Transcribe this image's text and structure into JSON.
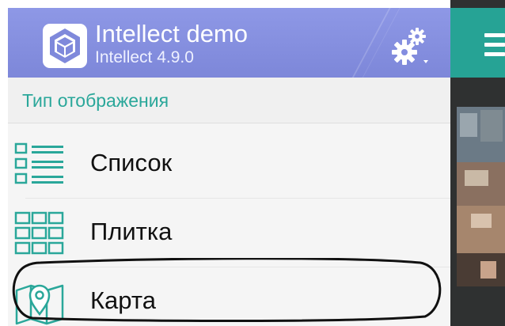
{
  "app": {
    "title": "Intellect demo",
    "version": "Intellect 4.9.0",
    "header_color": "#8792e0",
    "accent_color": "#2aa79a"
  },
  "header": {
    "logo_icon": "intellect-logo-icon",
    "settings_icon": "gears-icon"
  },
  "view_menu": {
    "section_label": "Тип отображения",
    "items": [
      {
        "label": "Список",
        "icon": "list-view-icon"
      },
      {
        "label": "Плитка",
        "icon": "tile-view-icon"
      },
      {
        "label": "Карта",
        "icon": "map-pin-icon",
        "highlighted": true
      }
    ]
  },
  "main": {
    "toolbar_color": "#26a395",
    "menu_icon": "hamburger-icon",
    "thumbnail": "camera-feed-preview"
  }
}
